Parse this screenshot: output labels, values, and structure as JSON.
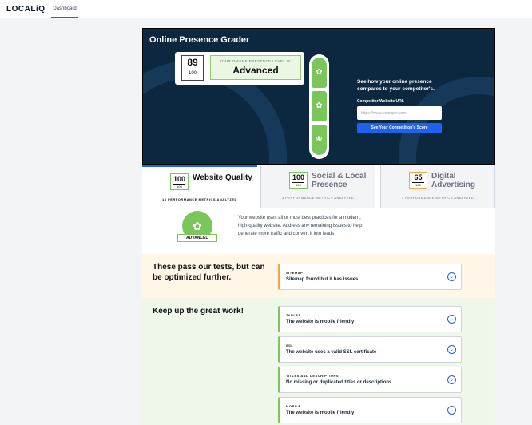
{
  "header": {
    "logo": "LOCALiQ",
    "tabs": [
      {
        "label": "Dashboard"
      }
    ]
  },
  "hero": {
    "title": "Online Presence Grader",
    "score": "89",
    "score_max": "100",
    "level_label": "YOUR ONLINE PRESENCE LEVEL IS:",
    "level": "Advanced",
    "level_icons": [
      "sprout-icon",
      "sprout-icon",
      "sprout-icon"
    ],
    "compete_title": "See how your online presence compares to your competitor's.",
    "competitor_label": "Competitor Website URL",
    "competitor_placeholder": "https://www.example.com",
    "competitor_value": "",
    "compete_button": "See Your Competition's Score"
  },
  "categories": [
    {
      "score": "100",
      "max": "100",
      "name": "Website Quality",
      "metrics": "13 PERFORMANCE METRICS ANALYZED",
      "active": true
    },
    {
      "score": "100",
      "max": "100",
      "name": "Social & Local Presence",
      "metrics": "3 PERFORMANCE METRICS ANALYZED",
      "active": false
    },
    {
      "score": "65",
      "max": "100",
      "name": "Digital Advertising",
      "metrics": "3 PERFORMANCE METRICS ANALYZED",
      "active": false
    }
  ],
  "summary": {
    "badge": "ADVANCED",
    "text": "Your website uses all or most best practices for a modern, high-quality website. Address any remaining issues to help generate more traffic and convert it into leads."
  },
  "sections": {
    "warn_title": "These pass our tests, but can be optimized further.",
    "warn_items": [
      {
        "label": "SITEMAP",
        "desc": "Sitemap found but it has issues"
      }
    ],
    "good_title": "Keep up the great work!",
    "good_items": [
      {
        "label": "TABLET",
        "desc": "The website is mobile friendly"
      },
      {
        "label": "SSL",
        "desc": "The website uses a valid SSL certificate"
      },
      {
        "label": "TITLES AND DESCRIPTIONS",
        "desc": "No missing or duplicated titles or descriptions"
      },
      {
        "label": "MOBILE",
        "desc": "The website is mobile friendly"
      }
    ]
  },
  "colors": {
    "accent": "#1d63ed",
    "hero_bg": "#0c2841",
    "good": "#7bc65a",
    "warn": "#f2a644"
  }
}
